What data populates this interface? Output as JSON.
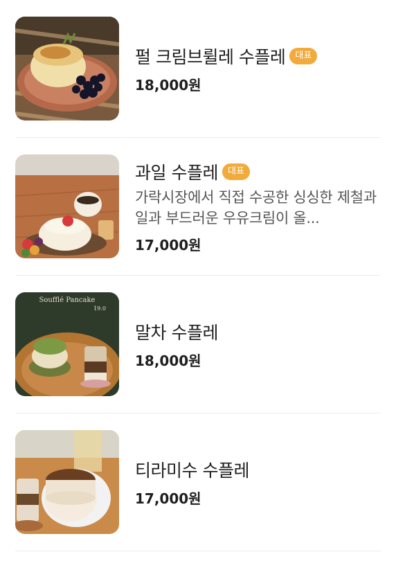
{
  "menu": {
    "items": [
      {
        "name": "펄 크림브륄레 수플레",
        "badge": "대표",
        "description": "",
        "price": "18,000원"
      },
      {
        "name": "과일 수플레",
        "badge": "대표",
        "description": "가락시장에서 직접 수공한 싱싱한 제철과일과 부드러운 우유크림이 올...",
        "price": "17,000원"
      },
      {
        "name": "말차 수플레",
        "badge": "",
        "description": "",
        "price": "18,000원"
      },
      {
        "name": "티라미수 수플레",
        "badge": "",
        "description": "",
        "price": "17,000원"
      }
    ],
    "thumb3_caption": "Soufflé Pancake",
    "thumb3_sub": "19.0",
    "badge_color": "#f2aa3a"
  }
}
